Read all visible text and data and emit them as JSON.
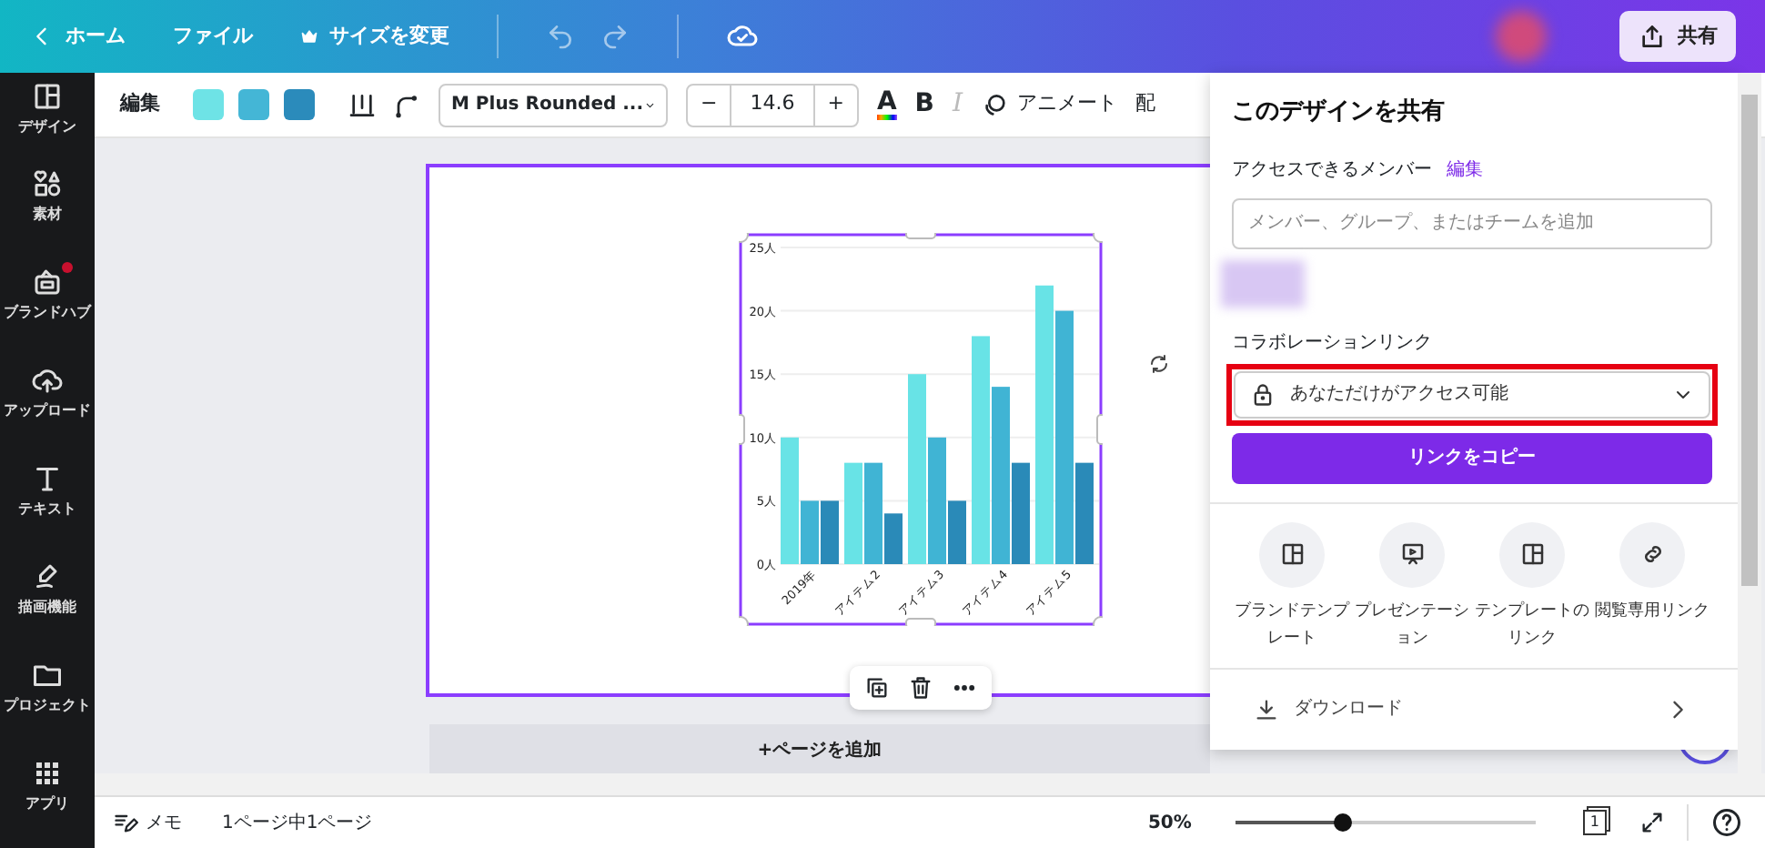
{
  "topbar": {
    "back": "ホーム",
    "file": "ファイル",
    "resize": "サイズを変更",
    "share": "共有"
  },
  "toolbar": {
    "edit": "編集",
    "swatches": [
      {
        "color": "#6ee3e6"
      },
      {
        "color": "#44b6d6"
      },
      {
        "color": "#2b8bbb"
      }
    ],
    "font": "M Plus Rounded ...",
    "minus": "−",
    "font_size": "14.6",
    "plus": "+",
    "text_color": "A",
    "bold": "B",
    "italic": "I",
    "italic_disabled": true,
    "animate": "アニメート",
    "position": "配"
  },
  "sidebar": {
    "items": [
      {
        "label": "デザイン",
        "notification": false
      },
      {
        "label": "素材",
        "notification": false
      },
      {
        "label": "ブランドハブ",
        "notification": true
      },
      {
        "label": "アップロード",
        "notification": false
      },
      {
        "label": "テキスト",
        "notification": false
      },
      {
        "label": "描画機能",
        "notification": false
      },
      {
        "label": "プロジェクト",
        "notification": false
      },
      {
        "label": "アプリ",
        "notification": false
      }
    ]
  },
  "canvas": {
    "chart_data": {
      "type": "bar",
      "categories": [
        "2019年",
        "アイテム2",
        "アイテム3",
        "アイテム4",
        "アイテム5"
      ],
      "series": [
        {
          "color": "#68e3e6",
          "values": [
            10,
            8,
            15,
            18,
            22
          ]
        },
        {
          "color": "#40b4d4",
          "values": [
            5,
            8,
            10,
            14,
            20
          ]
        },
        {
          "color": "#2a8ab8",
          "values": [
            5,
            4,
            5,
            8,
            8
          ]
        }
      ],
      "grid": true,
      "ylim": [
        0,
        25
      ],
      "yticks": [
        {
          "value": 0,
          "label": "0人"
        },
        {
          "value": 5,
          "label": "5人"
        },
        {
          "value": 10,
          "label": "10人"
        },
        {
          "value": 15,
          "label": "15人"
        },
        {
          "value": 20,
          "label": "20人"
        },
        {
          "value": 25,
          "label": "25人"
        }
      ]
    },
    "add_page": "+ページを追加"
  },
  "share_panel": {
    "title": "このデザインを共有",
    "members_label": "アクセスできるメンバー",
    "edit_link": "編集",
    "member_placeholder": "メンバー、グループ、またはチームを追加",
    "collab_label": "コラボレーションリンク",
    "access": "あなただけがアクセス可能",
    "copy_button": "リンクをコピー",
    "options": [
      {
        "label": "ブランドテンプレート"
      },
      {
        "label": "プレゼンテーション"
      },
      {
        "label": "テンプレートのリンク"
      },
      {
        "label": "閲覧専用リンク"
      }
    ],
    "download": "ダウンロード"
  },
  "status_bar": {
    "notes": "メモ",
    "pages": "1ページ中1ページ",
    "zoom": "50%",
    "level": 0.36,
    "page_count": "1"
  }
}
